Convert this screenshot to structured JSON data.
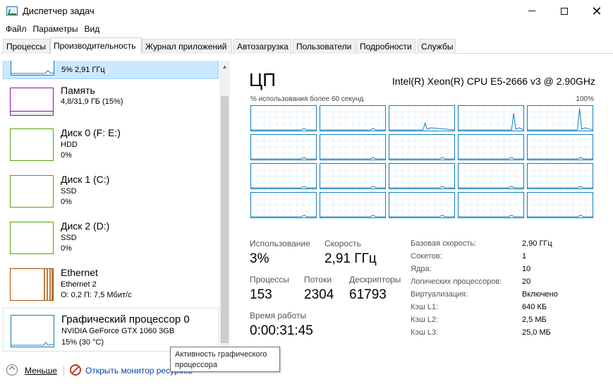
{
  "window": {
    "title": "Диспетчер задач"
  },
  "menu": [
    "Файл",
    "Параметры",
    "Вид"
  ],
  "tabs": [
    "Процессы",
    "Производительность",
    "Журнал приложений",
    "Автозагрузка",
    "Пользователи",
    "Подробности",
    "Службы"
  ],
  "active_tab": "Производительность",
  "left_items": [
    {
      "name": "",
      "sub1": "",
      "sub2": "5% 2,91 ГГц",
      "selected": true,
      "color": "#117dbb"
    },
    {
      "name": "Память",
      "sub1": "",
      "sub2": "4,8/31,9 ГБ (15%)",
      "selected": false,
      "color": "#8b12ae"
    },
    {
      "name": "Диск 0 (F: E:)",
      "sub1": "HDD",
      "sub2": "0%",
      "selected": false,
      "color": "#4da60c"
    },
    {
      "name": "Диск 1 (C:)",
      "sub1": "SSD",
      "sub2": "0%",
      "selected": false,
      "color": "#4da60c"
    },
    {
      "name": "Диск 2 (D:)",
      "sub1": "SSD",
      "sub2": "0%",
      "selected": false,
      "color": "#4da60c"
    },
    {
      "name": "Ethernet",
      "sub1": "Ethernet 2",
      "sub2": "О: 0,2  П: 7,5 Мбит/с",
      "selected": false,
      "color": "#a74f01"
    },
    {
      "name": "Графический процессор 0",
      "sub1": "NVIDIA GeForce GTX 1060 3GB",
      "sub2": "15% (30 °C)",
      "selected": false,
      "color": "#117dbb"
    }
  ],
  "cpu": {
    "title": "ЦП",
    "model": "Intel(R) Xeon(R) CPU E5-2666 v3 @ 2.90GHz",
    "graph_caption": "% использования более 60 секунд",
    "graph_max": "100%",
    "stats": {
      "usage_label": "Использование",
      "usage_value": "3%",
      "speed_label": "Скорость",
      "speed_value": "2,91 ГГц",
      "processes_label": "Процессы",
      "processes_value": "153",
      "threads_label": "Потоки",
      "threads_value": "2304",
      "handles_label": "Дескрипторы",
      "handles_value": "61793",
      "uptime_label": "Время работы",
      "uptime_value": "0:00:31:45"
    },
    "details": [
      {
        "label": "Базовая скорость:",
        "value": "2,90 ГГц"
      },
      {
        "label": "Сокетов:",
        "value": "1"
      },
      {
        "label": "Ядра:",
        "value": "10"
      },
      {
        "label": "Логических процессоров:",
        "value": "20"
      },
      {
        "label": "Виртуализация:",
        "value": "Включено"
      },
      {
        "label": "Кэш L1:",
        "value": "640 КБ"
      },
      {
        "label": "Кэш L2:",
        "value": "2,5 МБ"
      },
      {
        "label": "Кэш L3:",
        "value": "25,0 МБ"
      }
    ]
  },
  "bottom": {
    "fewer": "Меньше",
    "resmon": "Открыть монитор ресурсов"
  },
  "tooltip": "Активность графического процессора",
  "colors": {
    "cpu": "#117dbb",
    "memory": "#8b12ae",
    "disk": "#4da60c",
    "ethernet": "#a74f01",
    "selected_bg": "#cce8ff"
  }
}
